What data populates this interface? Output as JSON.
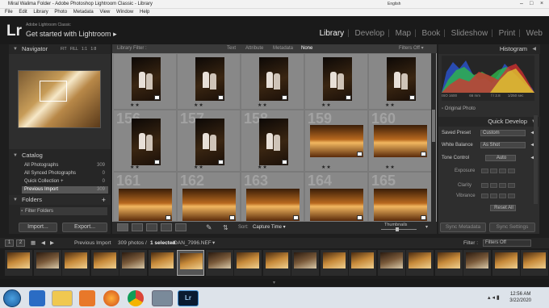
{
  "window": {
    "title": "Miral Walima Folder - Adobe Photoshop Lightroom Classic - Library",
    "language": "English",
    "menus": [
      "File",
      "Edit",
      "Library",
      "Photo",
      "Metadata",
      "View",
      "Window",
      "Help"
    ]
  },
  "header": {
    "logo": "Lr",
    "app_name": "Adobe Lightroom Classic",
    "tagline": "Get started with Lightroom",
    "modules": [
      "Library",
      "Develop",
      "Map",
      "Book",
      "Slideshow",
      "Print",
      "Web"
    ],
    "active_module": "Library"
  },
  "navigator": {
    "title": "Navigator",
    "zoom": [
      "FIT",
      "FILL",
      "1:1",
      "1:8"
    ]
  },
  "catalog": {
    "title": "Catalog",
    "items": [
      {
        "label": "All Photographs",
        "count": "309"
      },
      {
        "label": "All Synced Photographs",
        "count": "0"
      },
      {
        "label": "Quick Collection +",
        "count": "0"
      },
      {
        "label": "Previous Import",
        "count": "309"
      }
    ]
  },
  "folders": {
    "title": "Folders",
    "filter_label": "Filter Folders"
  },
  "left_buttons": {
    "import": "Import...",
    "export": "Export..."
  },
  "library_filter": {
    "title": "Library Filter :",
    "options": [
      "Text",
      "Attribute",
      "Metadata",
      "None"
    ],
    "active": "None",
    "filters_state": "Filters Off"
  },
  "grid": {
    "rows": [
      {
        "cells": [
          {
            "num": "",
            "stars": "★★",
            "kind": "tall"
          },
          {
            "num": "",
            "stars": "★★",
            "kind": "tall"
          },
          {
            "num": "",
            "stars": "★★",
            "kind": "tall"
          },
          {
            "num": "",
            "stars": "★★",
            "kind": "tall"
          },
          {
            "num": "",
            "stars": "★★",
            "kind": "tall"
          }
        ]
      },
      {
        "cells": [
          {
            "num": "156",
            "stars": "★★",
            "kind": "tall"
          },
          {
            "num": "157",
            "stars": "★★",
            "kind": "tall"
          },
          {
            "num": "158",
            "stars": "★★",
            "kind": "tall"
          },
          {
            "num": "159",
            "stars": "★★",
            "kind": "wide"
          },
          {
            "num": "160",
            "stars": "★★",
            "kind": "wide"
          }
        ]
      },
      {
        "cells": [
          {
            "num": "161",
            "stars": "",
            "kind": "wide"
          },
          {
            "num": "162",
            "stars": "",
            "kind": "wide"
          },
          {
            "num": "163",
            "stars": "",
            "kind": "wide"
          },
          {
            "num": "164",
            "stars": "",
            "kind": "wide"
          },
          {
            "num": "165",
            "stars": "",
            "kind": "wide"
          }
        ]
      }
    ]
  },
  "toolbar": {
    "sort_label": "Sort:",
    "sort_value": "Capture Time",
    "thumbnails_label": "Thumbnails"
  },
  "histogram": {
    "title": "Histogram",
    "iso": "ISO 1600",
    "focal": "66 mm",
    "aperture": "f / 2.8",
    "shutter": "1/250 sec",
    "original_photo": "Original Photo"
  },
  "quick_develop": {
    "title": "Quick Develop",
    "saved_preset_label": "Saved Preset",
    "saved_preset_value": "Custom",
    "white_balance_label": "White Balance",
    "white_balance_value": "As Shot",
    "tone_control_label": "Tone Control",
    "tone_control_value": "Auto",
    "sliders": [
      "Exposure",
      "Clarity",
      "Vibrance"
    ],
    "reset": "Reset All"
  },
  "right_buttons": {
    "sync_metadata": "Sync Metadata",
    "sync_settings": "Sync Settings"
  },
  "filmstrip_bar": {
    "pages": [
      "1",
      "2"
    ],
    "source": "Previous Import",
    "count_text": "309 photos /",
    "selected_text": "1 selected",
    "file": "/OAN_7996.NEF",
    "filter_label": "Filter :",
    "filter_value": "Filters Off"
  },
  "filmstrip": {
    "count": 19,
    "selected_index": 6
  },
  "taskbar": {
    "time": "12:56 AM",
    "date": "3/22/2020",
    "apps": [
      "ie-icon",
      "file-explorer-icon",
      "media-player-icon",
      "firefox-icon",
      "chrome-icon",
      "app-icon",
      "lightroom-icon"
    ]
  },
  "colors": {
    "panel_bg": "#2e2e2e",
    "grid_bg": "#969696",
    "active_module": "#f5f5f5",
    "selection": "#575757"
  }
}
